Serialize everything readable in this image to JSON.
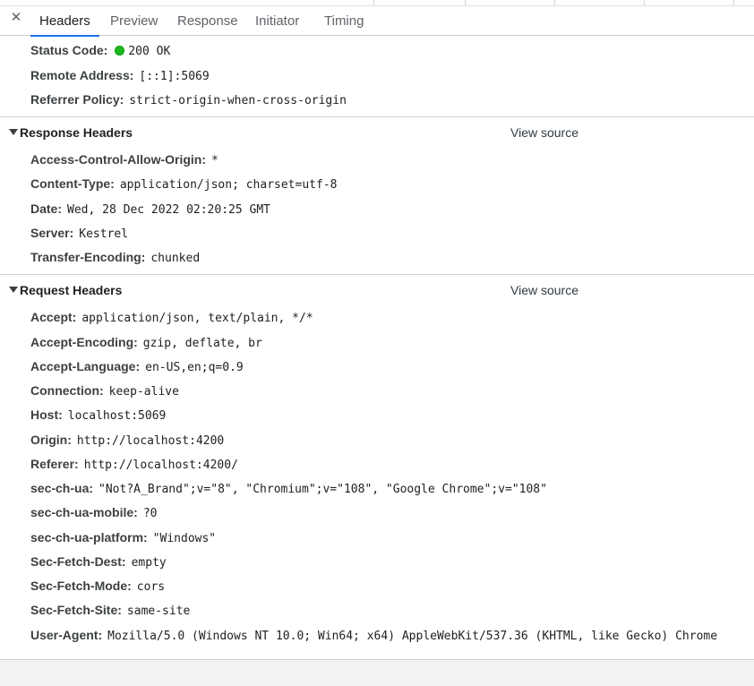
{
  "tabs": {
    "close_label": "✕",
    "items": [
      {
        "label": "Headers",
        "active": true
      },
      {
        "label": "Preview"
      },
      {
        "label": "Response"
      },
      {
        "label": "Initiator"
      },
      {
        "label": "Timing"
      }
    ]
  },
  "general": {
    "status_code": {
      "key": "Status Code:",
      "value": "200 OK",
      "status_color": "#1eb71e"
    },
    "remote_address": {
      "key": "Remote Address:",
      "value": "[::1]:5069"
    },
    "referrer_policy": {
      "key": "Referrer Policy:",
      "value": "strict-origin-when-cross-origin"
    }
  },
  "response_headers": {
    "title": "Response Headers",
    "view_source": "View source",
    "items": [
      {
        "key": "Access-Control-Allow-Origin:",
        "value": "*"
      },
      {
        "key": "Content-Type:",
        "value": "application/json; charset=utf-8"
      },
      {
        "key": "Date:",
        "value": "Wed, 28 Dec 2022 02:20:25 GMT"
      },
      {
        "key": "Server:",
        "value": "Kestrel"
      },
      {
        "key": "Transfer-Encoding:",
        "value": "chunked"
      }
    ]
  },
  "request_headers": {
    "title": "Request Headers",
    "view_source": "View source",
    "items": [
      {
        "key": "Accept:",
        "value": "application/json, text/plain, */*"
      },
      {
        "key": "Accept-Encoding:",
        "value": "gzip, deflate, br"
      },
      {
        "key": "Accept-Language:",
        "value": "en-US,en;q=0.9"
      },
      {
        "key": "Connection:",
        "value": "keep-alive"
      },
      {
        "key": "Host:",
        "value": "localhost:5069"
      },
      {
        "key": "Origin:",
        "value": "http://localhost:4200"
      },
      {
        "key": "Referer:",
        "value": "http://localhost:4200/"
      },
      {
        "key": "sec-ch-ua:",
        "value": "\"Not?A_Brand\";v=\"8\", \"Chromium\";v=\"108\", \"Google Chrome\";v=\"108\""
      },
      {
        "key": "sec-ch-ua-mobile:",
        "value": "?0"
      },
      {
        "key": "sec-ch-ua-platform:",
        "value": "\"Windows\""
      },
      {
        "key": "Sec-Fetch-Dest:",
        "value": "empty"
      },
      {
        "key": "Sec-Fetch-Mode:",
        "value": "cors"
      },
      {
        "key": "Sec-Fetch-Site:",
        "value": "same-site"
      },
      {
        "key": "User-Agent:",
        "value": "Mozilla/5.0 (Windows NT 10.0; Win64; x64) AppleWebKit/537.36 (KHTML, like Gecko) Chrome"
      }
    ]
  },
  "colors": {
    "accent": "#1a73e8"
  }
}
